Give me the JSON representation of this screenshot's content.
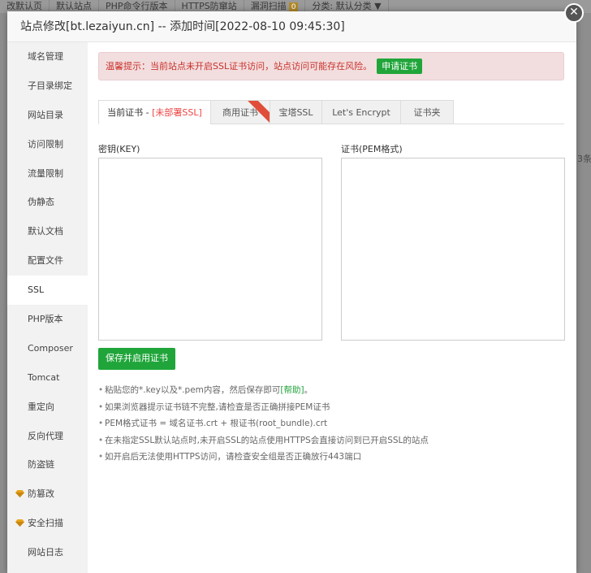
{
  "background": {
    "toolbar": [
      "改默认页",
      "默认站点",
      "PHP命令行版本",
      "HTTPS防窜站",
      "漏洞扫描",
      "分类: 默认分类 ▼"
    ],
    "scan_badge": "0",
    "right_fragments": [
      "",
      "",
      "",
      "3条"
    ]
  },
  "dialog": {
    "title": "站点修改[bt.lezaiyun.cn] -- 添加时间[2022-08-10 09:45:30]",
    "close_glyph": "✕"
  },
  "sidebar": {
    "items": [
      {
        "label": "域名管理"
      },
      {
        "label": "子目录绑定"
      },
      {
        "label": "网站目录"
      },
      {
        "label": "访问限制"
      },
      {
        "label": "流量限制"
      },
      {
        "label": "伪静态"
      },
      {
        "label": "默认文档"
      },
      {
        "label": "配置文件"
      },
      {
        "label": "SSL",
        "active": true
      },
      {
        "label": "PHP版本"
      },
      {
        "label": "Composer"
      },
      {
        "label": "Tomcat"
      },
      {
        "label": "重定向"
      },
      {
        "label": "反向代理"
      },
      {
        "label": "防盗链"
      },
      {
        "label": "防篡改",
        "icon": "gem-icon"
      },
      {
        "label": "安全扫描",
        "icon": "gem-icon"
      },
      {
        "label": "网站日志"
      }
    ]
  },
  "alert": {
    "text": "温馨提示：当前站点未开启SSL证书访问，站点访问可能存在风险。",
    "button": "申请证书"
  },
  "tabs": {
    "current_prefix": "当前证书 - ",
    "current_status": "[未部署SSL]",
    "commercial": "商用证书",
    "baota": "宝塔SSL",
    "letsencrypt": "Let's Encrypt",
    "cert_folder": "证书夹"
  },
  "form": {
    "key_label": "密钥(KEY)",
    "key_value": "",
    "cert_label": "证书(PEM格式)",
    "cert_value": "",
    "save_button": "保存并启用证书"
  },
  "tips": {
    "tip1_prefix": "粘贴您的*.key以及*.pem内容，然后保存即可",
    "tip1_help": "[帮助]",
    "tip1_suffix": "。",
    "tip2": "如果浏览器提示证书链不完整,请检查是否正确拼接PEM证书",
    "tip3": "PEM格式证书 = 域名证书.crt + 根证书(root_bundle).crt",
    "tip4": "在未指定SSL默认站点时,未开启SSL的站点使用HTTPS会直接访问到已开启SSL的站点",
    "tip5": "如开启后无法使用HTTPS访问，请检查安全组是否正确放行443端口"
  },
  "colors": {
    "accent_green": "#20a53a",
    "alert_red": "#c9302c",
    "ribbon_red": "#e04e39"
  }
}
